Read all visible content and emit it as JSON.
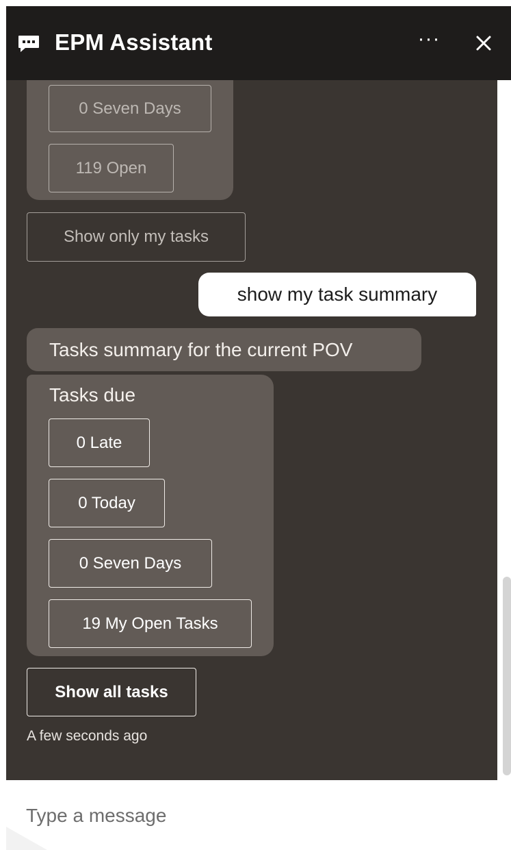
{
  "header": {
    "title": "EPM Assistant",
    "more_label": "···",
    "icons": {
      "chat": "chat-bubble-icon",
      "more": "more-icon",
      "close": "close-icon"
    }
  },
  "conversation": {
    "previous_card": {
      "tiles": [
        "0 Seven Days",
        "119 Open"
      ]
    },
    "show_only_mine": "Show only my tasks",
    "user_message": "show my task summary",
    "bot_message": "Tasks summary for the current POV",
    "tasks_card": {
      "heading": "Tasks due",
      "tiles": [
        "0 Late",
        "0 Today",
        "0 Seven Days",
        "19 My Open Tasks"
      ]
    },
    "show_all": "Show all tasks",
    "timestamp": "A few seconds ago"
  },
  "composer": {
    "placeholder": "Type a message"
  },
  "colors": {
    "header": "#1e1c1b",
    "conversation": "#3a3531",
    "card": "#625b56",
    "user_bubble": "#ffffff"
  }
}
